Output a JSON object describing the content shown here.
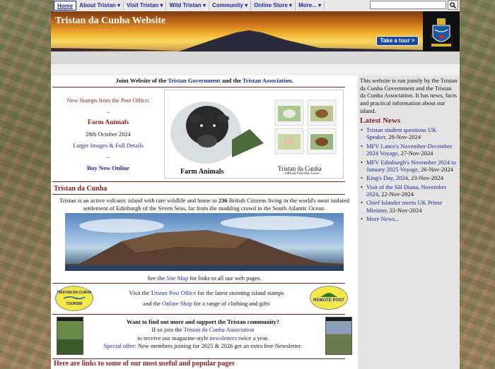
{
  "nav": {
    "tabs": [
      "Home",
      "About Tristan ▾",
      "Visit Tristan ▾",
      "Wild Tristan ▾",
      "Community ▾",
      "Online Store ▾",
      "More... ▾"
    ],
    "search_placeholder": ""
  },
  "banner": {
    "title": "Tristan da Cunha Website",
    "tour_button": "Take a tour >"
  },
  "main": {
    "joint_prefix": "Joint Website of the ",
    "joint_gov": "Tristan Government",
    "joint_mid": " and the ",
    "joint_assoc": "Tristan Association",
    "joint_end": ".",
    "stamps": {
      "heading": "New Stamps from the Post Office:",
      "dash1": "–",
      "name": "Farm Animals",
      "date": "28th October 2024",
      "details_link": "Larger Images & Full Details",
      "dash2": "–",
      "buy_link": "Buy Now Online",
      "cover_label": "Farm Animals",
      "cover_brand": "Tristan da Cunha",
      "cover_sub": "Official First Day Cover",
      "stamp_brand": "Tristan da Cunha"
    },
    "section_title": "Tristan da Cunha",
    "intro_1": "Tristan is an active volcanic island with rare wildlife and home to ",
    "intro_bold": "236",
    "intro_2": " British Citizens living in the world's most isolated settlement of Edinburgh of the Seven Seas, far from the madding crowd in the South Atlantic Ocean.",
    "sitemap_pre": "See the ",
    "sitemap_link": "Site Map",
    "sitemap_post": " for links to all our web pages.",
    "post": {
      "line1_pre": "Visit the ",
      "line1_link": "Tristan Post Office",
      "line1_post": " for the latest stunning island stamps",
      "line2_pre": "and the ",
      "line2_link": "Online Shop",
      "line2_post": " for a range of clothing and gifts",
      "logo1_text": "TRISTAN DA CUNHA",
      "logo1_sub": "TOURISM",
      "logo2_text": "REMOTE POST"
    },
    "assoc": {
      "line1": "Want to find out more and support the Tristan community?",
      "line2_pre": "If so join the ",
      "line2_link": "Tristan da Cunha Association",
      "line3_pre": "to receive our magazine-style ",
      "line3_link": "newsletters",
      "line3_post": " twice a year.",
      "line4_label": "Special offer:",
      "line4_text": " New members joining for 2025 & 2026 get an extra free Newsletter."
    },
    "links_title": "Here are links to some of our most useful and popular pages"
  },
  "sidebar": {
    "intro": "This website is run jointly by the Tristan da Cunha Government and the Tristan da Cunha Association. It has news, facts and practical information about our island.",
    "news_title": "Latest News",
    "news": [
      {
        "link": "Tristan student questions UK Speaker",
        "date": ", 28-Nov-2024"
      },
      {
        "link": "MFV Lance's November-December 2024 Voyage",
        "date": ", 27-Nov-2024"
      },
      {
        "link": "MFV Edinburgh's November 2024 to January 2025 Voyage",
        "date": ", 26-Nov-2024"
      },
      {
        "link": "King's Day, 2024",
        "date": ", 23-Nov-2024"
      },
      {
        "link": "Visit of the SH Diana, November 2024",
        "date": ", 22-Nov-2024"
      },
      {
        "link": "Chief Islander meets UK Prime Minister",
        "date": ", 22-Nov-2024"
      },
      {
        "link": "More News...",
        "date": ""
      }
    ]
  },
  "colors": {
    "accent": "#8b1a1a",
    "link": "#1a2a9a",
    "tour_button": "#1a4aa0"
  }
}
